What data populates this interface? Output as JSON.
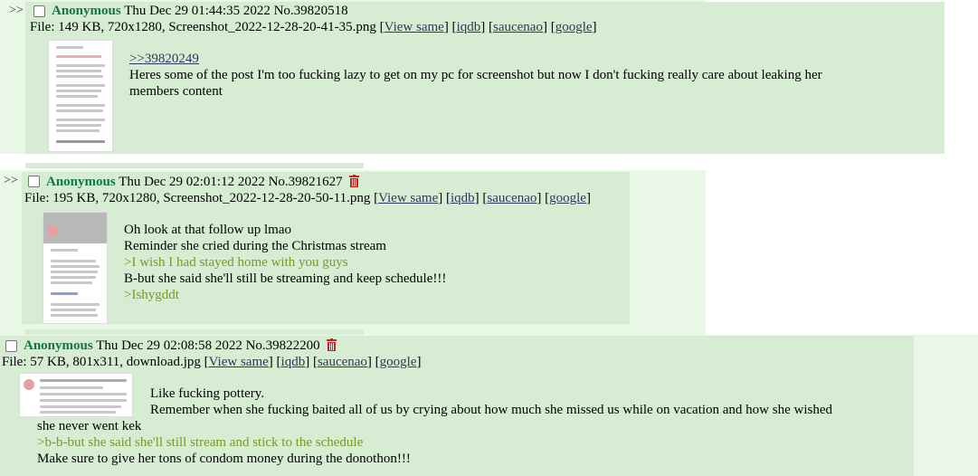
{
  "posts": [
    {
      "arrows": ">>",
      "name": "Anonymous",
      "datetime": "Thu Dec 29 01:44:35 2022",
      "number": "No.39820518",
      "file_info": "File: 149 KB, 720x1280, Screenshot_2022-12-28-20-41-35.png",
      "links": [
        "View same",
        "iqdb",
        "saucenao",
        "google"
      ],
      "reply_link": ">>39820249",
      "lines": [
        {
          "text": "Heres some of the post I'm too fucking lazy to get on my pc for screenshot but now I don't fucking really care about leaking her",
          "quote": false
        },
        {
          "text": "members content",
          "quote": false
        }
      ]
    },
    {
      "arrows": ">>",
      "name": "Anonymous",
      "datetime": "Thu Dec 29 02:01:12 2022",
      "number": "No.39821627",
      "file_info": "File: 195 KB, 720x1280, Screenshot_2022-12-28-20-50-11.png",
      "links": [
        "View same",
        "iqdb",
        "saucenao",
        "google"
      ],
      "lines": [
        {
          "text": "Oh look at that follow up lmao",
          "quote": false
        },
        {
          "text": "Reminder she cried during the Christmas stream",
          "quote": false
        },
        {
          "text": ">I wish I had stayed home with you guys",
          "quote": true
        },
        {
          "text": "B-but she said she'll still be streaming and keep schedule!!!",
          "quote": false
        },
        {
          "text": ">Ishygddt",
          "quote": true
        }
      ]
    },
    {
      "name": "Anonymous",
      "datetime": "Thu Dec 29 02:08:58 2022",
      "number": "No.39822200",
      "file_info": "File: 57 KB, 801x311, download.jpg",
      "links": [
        "View same",
        "iqdb",
        "saucenao",
        "google"
      ],
      "lines": [
        {
          "text": "Like fucking pottery.",
          "quote": false
        },
        {
          "text": "Remember when she fucking baited all of us by crying about how much she missed us while on vacation and how she wished",
          "quote": false
        },
        {
          "text": "she never went kek",
          "quote": false
        },
        {
          "text": ">b-b-but she said she'll still stream and stick to the schedule",
          "quote": true
        },
        {
          "text": "Make sure to give her tons of condom money during the donothon!!!",
          "quote": false
        }
      ]
    }
  ],
  "colors": {
    "name": "#117743",
    "quote": "#789922",
    "link": "#34345c",
    "post_bg": "#d6edd4",
    "page_bg": "#e9f7e6",
    "trash": "#cc2020"
  }
}
